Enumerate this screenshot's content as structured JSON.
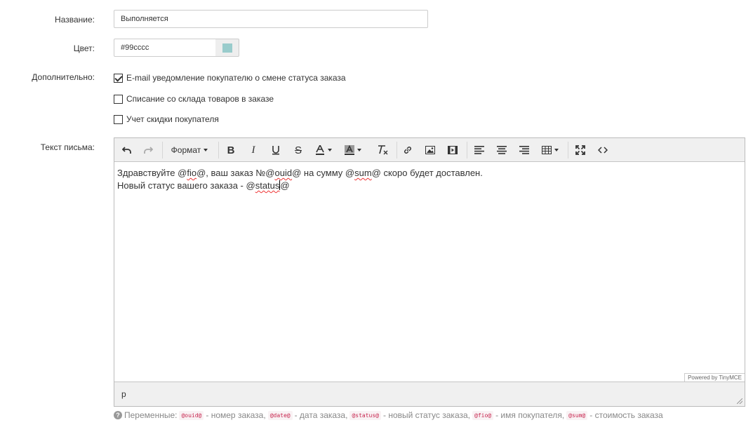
{
  "form": {
    "name_label": "Название:",
    "name_value": "Выполняется",
    "color_label": "Цвет:",
    "color_value": "#99cccc",
    "color_swatch": "#99cccc",
    "extra_label": "Дополнительно:",
    "checkboxes": [
      {
        "label": "E-mail уведомление покупателю о смене статуса заказа",
        "checked": true
      },
      {
        "label": "Списание со склада товаров в заказе",
        "checked": false
      },
      {
        "label": "Учет скидки покупателя",
        "checked": false
      }
    ],
    "letter_label": "Текст письма:"
  },
  "editor": {
    "toolbar": {
      "format_label": "Формат",
      "icons": [
        "undo-icon",
        "redo-icon",
        "bold-icon",
        "italic-icon",
        "underline-icon",
        "strikethrough-icon",
        "text-color-icon",
        "background-color-icon",
        "clear-formatting-icon",
        "link-icon",
        "image-icon",
        "media-icon",
        "align-left-icon",
        "align-center-icon",
        "align-right-icon",
        "table-icon",
        "fullscreen-icon",
        "source-code-icon"
      ]
    },
    "content": {
      "line1": {
        "t1": "Здравствуйте @",
        "w1": "fio",
        "t2": "@, ваш заказ №@",
        "w2": "ouid",
        "t3": "@ на сумму @",
        "w3": "sum",
        "t4": "@ скоро будет доставлен."
      },
      "line2": {
        "t1": "Новый статус вашего заказа - @",
        "w1": "status",
        "t2": "@"
      }
    },
    "powered_by": "Powered by TinyMCE",
    "path": "p"
  },
  "help": {
    "prefix": "Переменные:",
    "items": [
      {
        "var": "@ouid@",
        "desc": "- номер заказа,"
      },
      {
        "var": "@date@",
        "desc": "- дата заказа,"
      },
      {
        "var": "@status@",
        "desc": "- новый статус заказа,"
      },
      {
        "var": "@fio@",
        "desc": "- имя покупателя,"
      },
      {
        "var": "@sum@",
        "desc": "- стоимость заказа"
      }
    ]
  }
}
